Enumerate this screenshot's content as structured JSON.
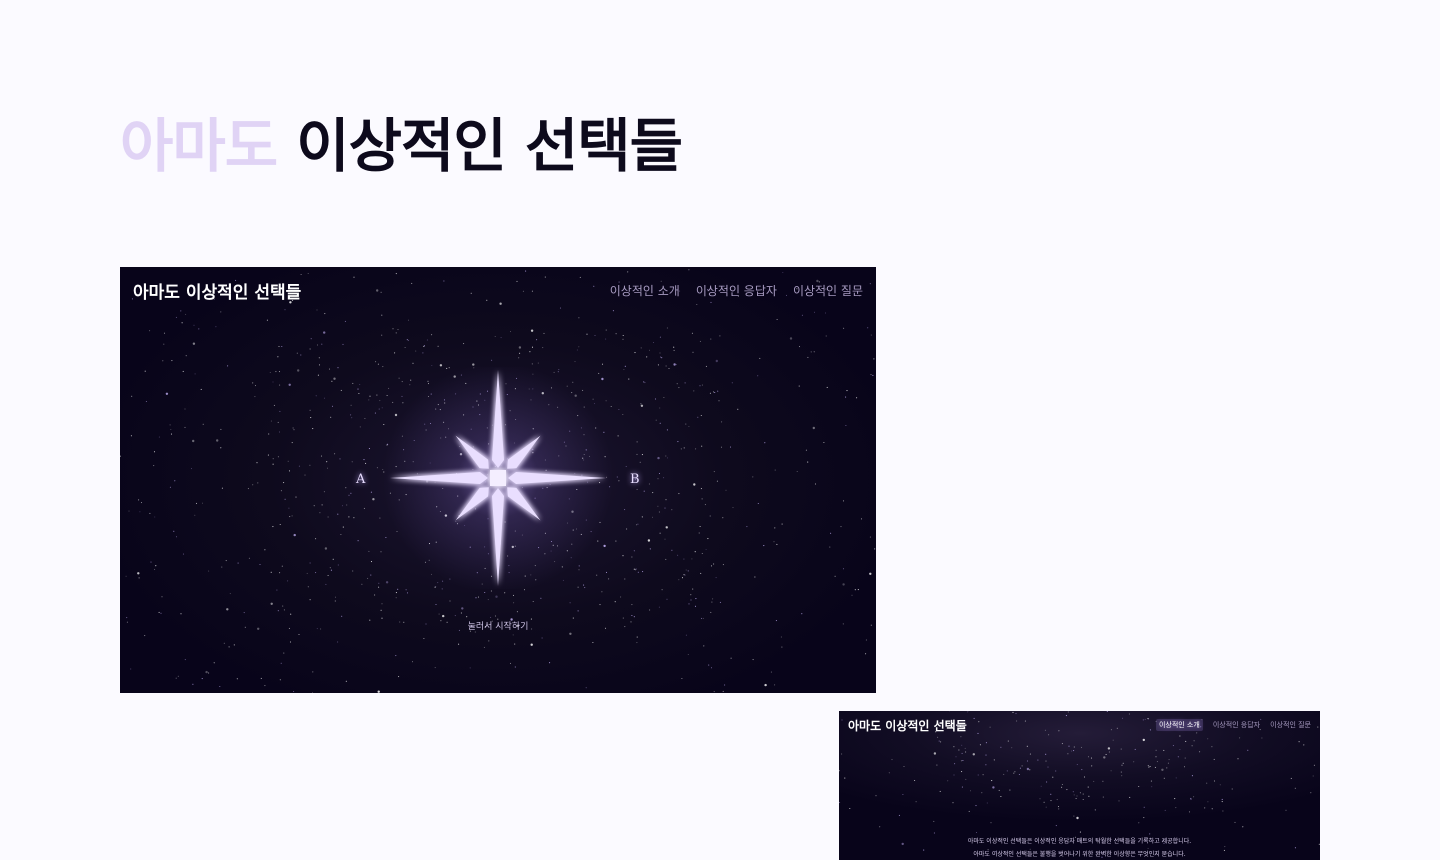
{
  "page": {
    "title_accent": "아마도",
    "title_main": "이상적인 선택들"
  },
  "hero_screenshot": {
    "brand": "아마도 이상적인 선택들",
    "nav": [
      "이상적인 소개",
      "이상적인 응답자",
      "이상적인 질문"
    ],
    "choice_a": "A",
    "choice_b": "B",
    "start_hint": "눌러서 시작하기",
    "compass_icon": "eight-point-star-compass",
    "colors": {
      "background": "#08041a",
      "glow": "#c8b3ff"
    }
  },
  "intro_screenshot": {
    "brand": "아마도 이상적인 선택들",
    "nav": [
      "이상적인 소개",
      "이상적인 응답자",
      "이상적인 질문"
    ],
    "active_nav": "이상적인 소개",
    "text_line1": "아마도 이상적인 선택들은 이상적인 응답자 매트의 탁월한 선택들을 기록하고 제공합니다.",
    "text_line2": "아마도 이상적인 선택들은 불행을 벗어나기 위한 완벽한 이상향은 무엇인지 묻습니다."
  },
  "colors": {
    "page_background": "#fbfaff",
    "title_accent": "#e0d3f5",
    "title_text": "#0d0a1c"
  }
}
